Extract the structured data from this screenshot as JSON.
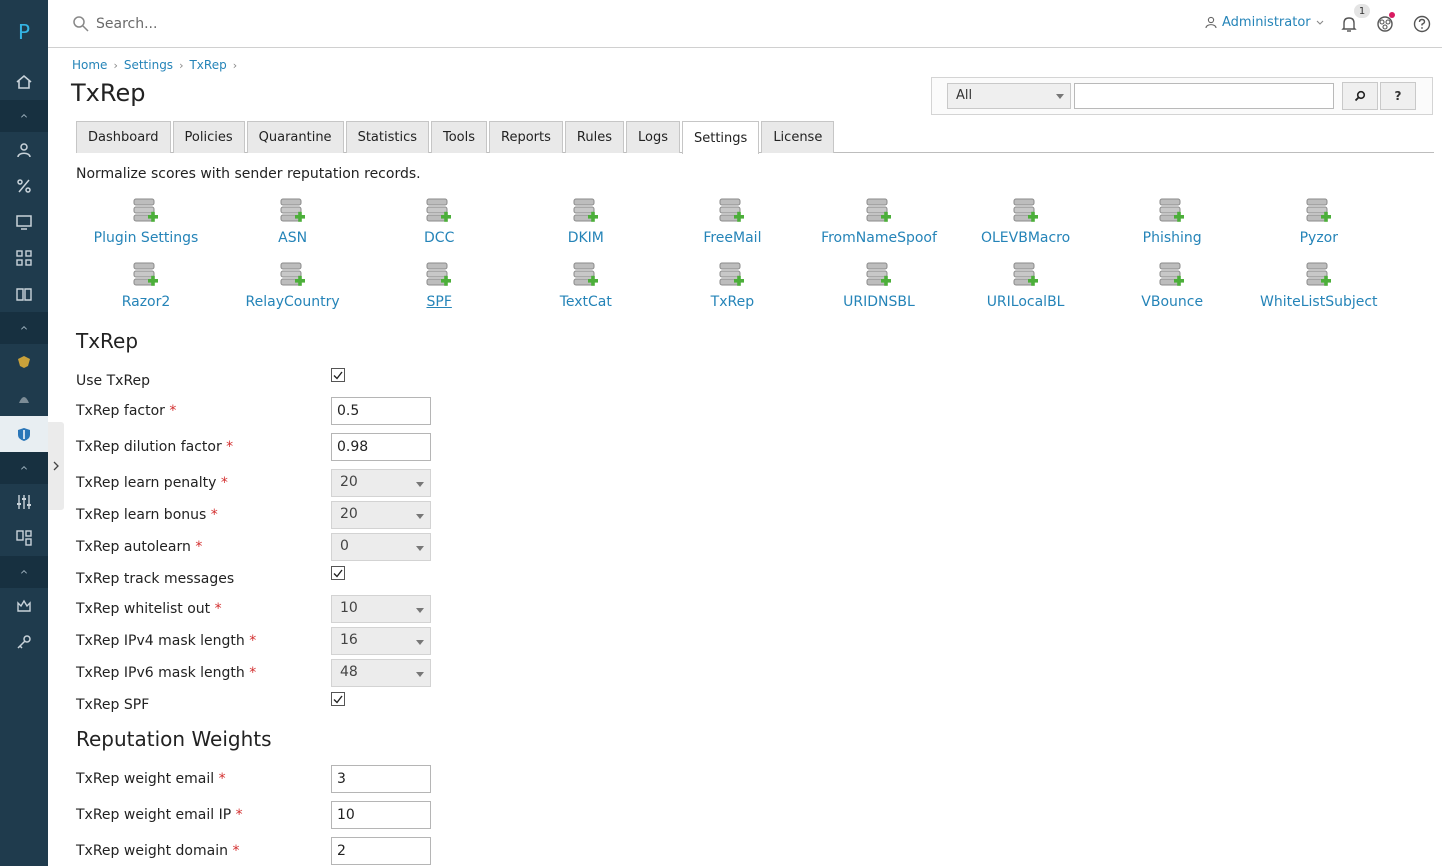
{
  "sidebar": {
    "logo": "P"
  },
  "topbar": {
    "search_placeholder": "Search...",
    "user": "Administrator",
    "notification_count": "1"
  },
  "breadcrumb": [
    "Home",
    "Settings",
    "TxRep"
  ],
  "page_title": "TxRep",
  "search": {
    "scope": "All",
    "query": "",
    "help_label": "?"
  },
  "tabs": [
    "Dashboard",
    "Policies",
    "Quarantine",
    "Statistics",
    "Tools",
    "Reports",
    "Rules",
    "Logs",
    "Settings",
    "License"
  ],
  "active_tab": "Settings",
  "description": "Normalize scores with sender reputation records.",
  "plugins": [
    "Plugin Settings",
    "ASN",
    "DCC",
    "DKIM",
    "FreeMail",
    "FromNameSpoof",
    "OLEVBMacro",
    "Phishing",
    "Pyzor",
    "Razor2",
    "RelayCountry",
    "SPF",
    "TextCat",
    "TxRep",
    "URIDNSBL",
    "URILocalBL",
    "VBounce",
    "WhiteListSubject"
  ],
  "txrep": {
    "heading": "TxRep",
    "use_txrep": {
      "label": "Use TxRep",
      "checked": true
    },
    "factor": {
      "label": "TxRep factor",
      "value": "0.5"
    },
    "dilution_factor": {
      "label": "TxRep dilution factor",
      "value": "0.98"
    },
    "learn_penalty": {
      "label": "TxRep learn penalty",
      "value": "20"
    },
    "learn_bonus": {
      "label": "TxRep learn bonus",
      "value": "20"
    },
    "autolearn": {
      "label": "TxRep autolearn",
      "value": "0"
    },
    "track_messages": {
      "label": "TxRep track messages",
      "checked": true
    },
    "whitelist_out": {
      "label": "TxRep whitelist out",
      "value": "10"
    },
    "ipv4_mask": {
      "label": "TxRep IPv4 mask length",
      "value": "16"
    },
    "ipv6_mask": {
      "label": "TxRep IPv6 mask length",
      "value": "48"
    },
    "spf": {
      "label": "TxRep SPF",
      "checked": true
    }
  },
  "weights": {
    "heading": "Reputation Weights",
    "email": {
      "label": "TxRep weight email",
      "value": "3"
    },
    "email_ip": {
      "label": "TxRep weight email IP",
      "value": "10"
    },
    "domain": {
      "label": "TxRep weight domain",
      "value": "2"
    }
  },
  "required_mark": "*",
  "colors": {
    "sidebar": "#1f3b4d",
    "link": "#2584b8",
    "required": "#d32f2f"
  }
}
